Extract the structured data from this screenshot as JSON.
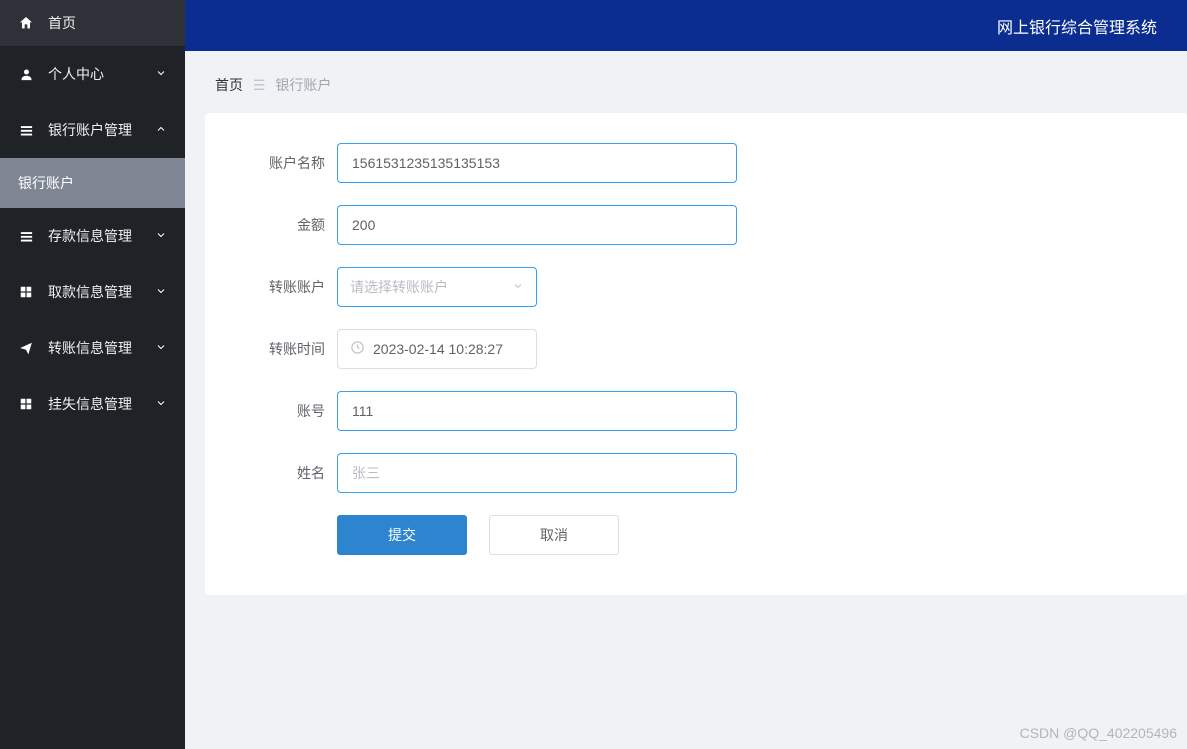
{
  "header": {
    "title": "网上银行综合管理系统"
  },
  "sidebar": {
    "home": "首页",
    "items": [
      {
        "label": "个人中心",
        "expanded": false
      },
      {
        "label": "银行账户管理",
        "expanded": true,
        "children": [
          "银行账户"
        ]
      },
      {
        "label": "存款信息管理",
        "expanded": false
      },
      {
        "label": "取款信息管理",
        "expanded": false
      },
      {
        "label": "转账信息管理",
        "expanded": false
      },
      {
        "label": "挂失信息管理",
        "expanded": false
      }
    ]
  },
  "breadcrumb": {
    "home": "首页",
    "current": "银行账户"
  },
  "form": {
    "accountNameLabel": "账户名称",
    "accountNameValue": "15615312351351351​53",
    "amountLabel": "金额",
    "amountValue": "200",
    "transferAccountLabel": "转账账户",
    "transferAccountPlaceholder": "请选择转账账户",
    "transferTimeLabel": "转账时间",
    "transferTimeValue": "2023-02-14 10:28:27",
    "accountNoLabel": "账号",
    "accountNoValue": "111",
    "nameLabel": "姓名",
    "namePlaceholder": "张三",
    "submit": "提交",
    "cancel": "取消"
  },
  "watermark": "CSDN @QQ_402205496"
}
